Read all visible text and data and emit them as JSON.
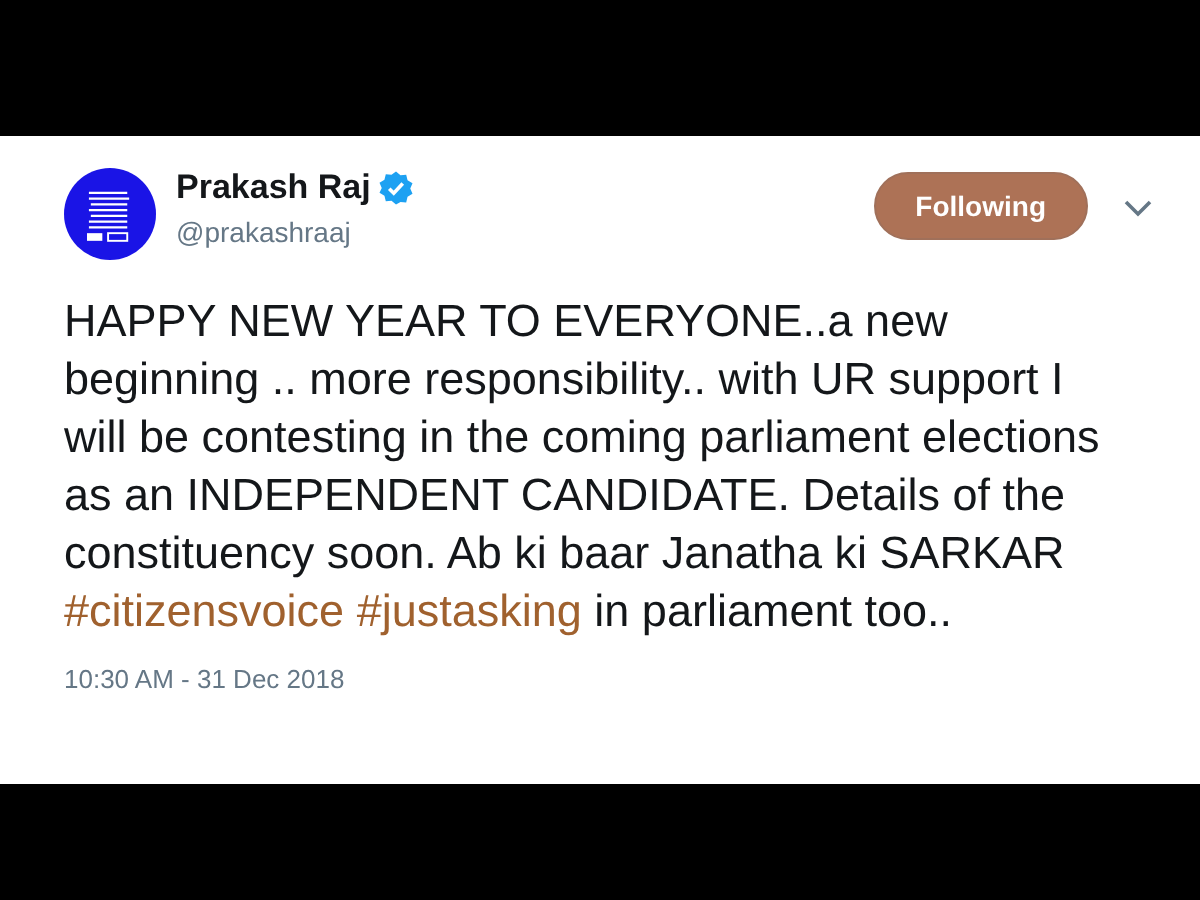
{
  "tweet": {
    "author": {
      "name": "Prakash Raj",
      "handle": "@prakashraaj",
      "verified": true
    },
    "follow_button": {
      "label": "Following",
      "selected": true
    },
    "body": [
      {
        "kind": "text",
        "text": "HAPPY NEW YEAR TO EVERYONE..a new beginning .. more responsibility.. with UR support I will be contesting in the coming parliament elections as an INDEPENDENT CANDIDATE. Details of the constituency soon. Ab ki baar Janatha ki  SARKAR "
      },
      {
        "kind": "hashtag",
        "text": "#citizensvoice"
      },
      {
        "kind": "hashtag",
        "text": "#justasking"
      },
      {
        "kind": "text",
        "text": " in parliament too.."
      }
    ],
    "timestamp": "10:30 AM - 31 Dec 2018"
  }
}
